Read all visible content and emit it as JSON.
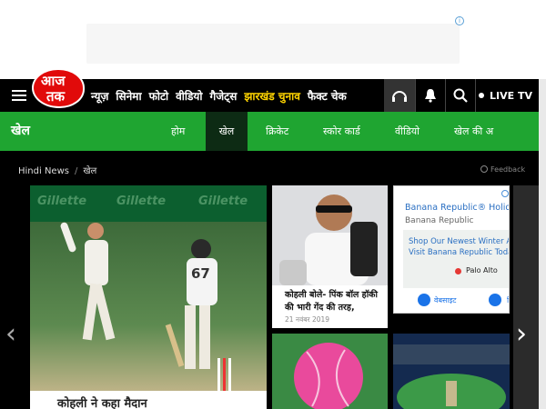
{
  "header": {
    "logo_line1": "आज",
    "logo_line2": "तक",
    "nav": [
      "न्यूज़",
      "सिनेमा",
      "फोटो",
      "वीडियो",
      "गैजेट्स",
      "झारखंड चुनाव",
      "फैक्ट चेक"
    ],
    "live_tv": "LIVE TV"
  },
  "section": {
    "title": "खेल",
    "tabs": [
      "होम",
      "खेल",
      "क्रिकेट",
      "स्कोर कार्ड",
      "वीडियो",
      "खेल की अ"
    ]
  },
  "breadcrumb": {
    "home": "Hindi News",
    "current": "खेल",
    "feedback": "Feedback"
  },
  "cards": {
    "hero": {
      "board_text": "Gillette",
      "jersey_number": "67",
      "bottom_text": "कोहली ने कहा मैदान"
    },
    "card2": {
      "title": "कोहली बोले- पिंक बॉल हॉकी की भारी गेंद की तरह,",
      "date": "21 नवंबर 2019"
    },
    "ad": {
      "title": "Banana Republic® Holiday",
      "subtitle": "Banana Republic",
      "line1": "Shop Our Newest Winter Arri",
      "line2": "Visit Banana Republic Today",
      "place": "Palo Alto",
      "btn1": "वेबसाइट",
      "btn2": "दि"
    }
  },
  "colors": {
    "nav_bg": "#000000",
    "section_green": "#1fa531",
    "active_tab": "#0d2b14",
    "highlight": "#ffd400",
    "brand_red": "#e10a0a"
  }
}
